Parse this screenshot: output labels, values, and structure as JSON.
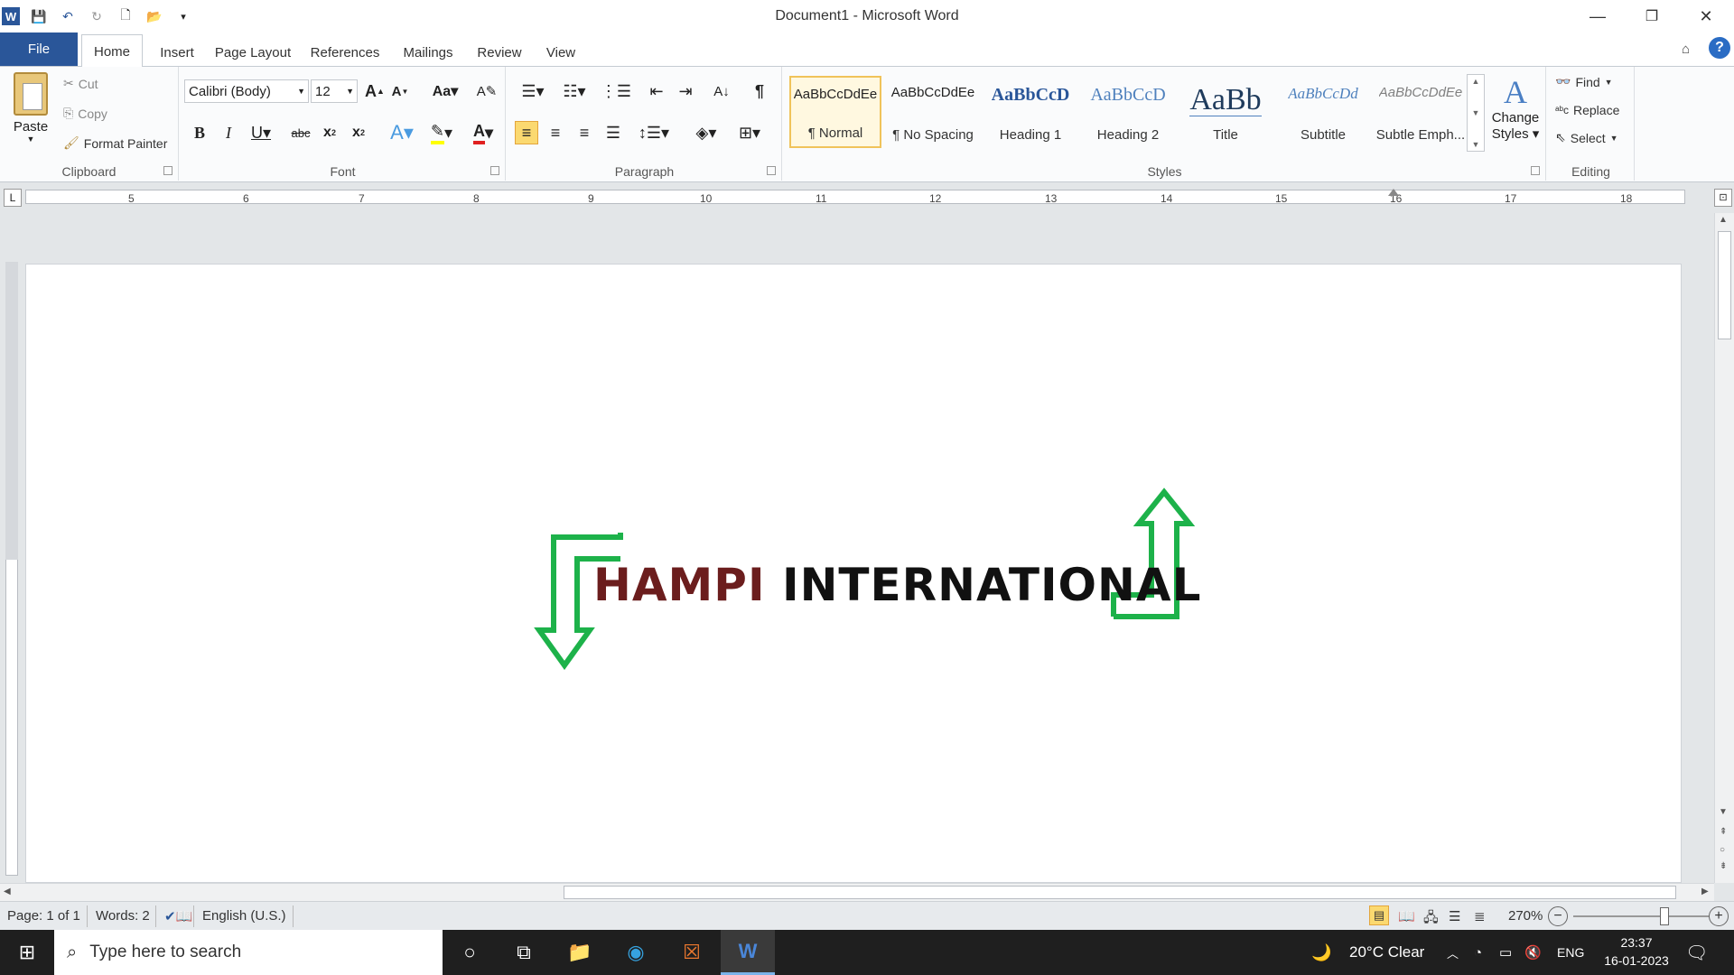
{
  "window": {
    "title": "Document1  -  Microsoft Word"
  },
  "tabs": [
    "File",
    "Home",
    "Insert",
    "Page Layout",
    "References",
    "Mailings",
    "Review",
    "View"
  ],
  "clipboard": {
    "paste": "Paste",
    "cut": "Cut",
    "copy": "Copy",
    "format_painter": "Format Painter",
    "label": "Clipboard"
  },
  "font": {
    "name": "Calibri (Body)",
    "size": "12",
    "label": "Font"
  },
  "paragraph": {
    "label": "Paragraph"
  },
  "styles": {
    "label": "Styles",
    "items": [
      {
        "sample": "AaBbCcDdEe",
        "name": "¶ Normal"
      },
      {
        "sample": "AaBbCcDdEe",
        "name": "¶ No Spacing"
      },
      {
        "sample": "AaBbCcD",
        "name": "Heading 1"
      },
      {
        "sample": "AaBbCcD",
        "name": "Heading 2"
      },
      {
        "sample": "AaBb",
        "name": "Title"
      },
      {
        "sample": "AaBbCcDd",
        "name": "Subtitle"
      },
      {
        "sample": "AaBbCcDdEe",
        "name": "Subtle Emph..."
      }
    ],
    "change_styles_1": "Change",
    "change_styles_2": "Styles"
  },
  "editing": {
    "find": "Find",
    "replace": "Replace",
    "select": "Select",
    "label": "Editing"
  },
  "ruler": {
    "numbers": [
      "5",
      "6",
      "7",
      "8",
      "9",
      "10",
      "11",
      "12",
      "13",
      "14",
      "15",
      "16",
      "17",
      "18"
    ]
  },
  "document": {
    "word1": "HAMPI",
    "word2": "INTERNATIONAL",
    "colors": {
      "word1": "#6b1d1d",
      "word2": "#111111",
      "arrows": "#1db24a"
    }
  },
  "status": {
    "page": "Page: 1 of 1",
    "words": "Words: 2",
    "language": "English (U.S.)",
    "zoom": "270%",
    "zoom_level_percent": 270
  },
  "taskbar": {
    "search_placeholder": "Type here to search",
    "weather": "20°C  Clear",
    "lang": "ENG",
    "time": "23:37",
    "date": "16-01-2023"
  }
}
